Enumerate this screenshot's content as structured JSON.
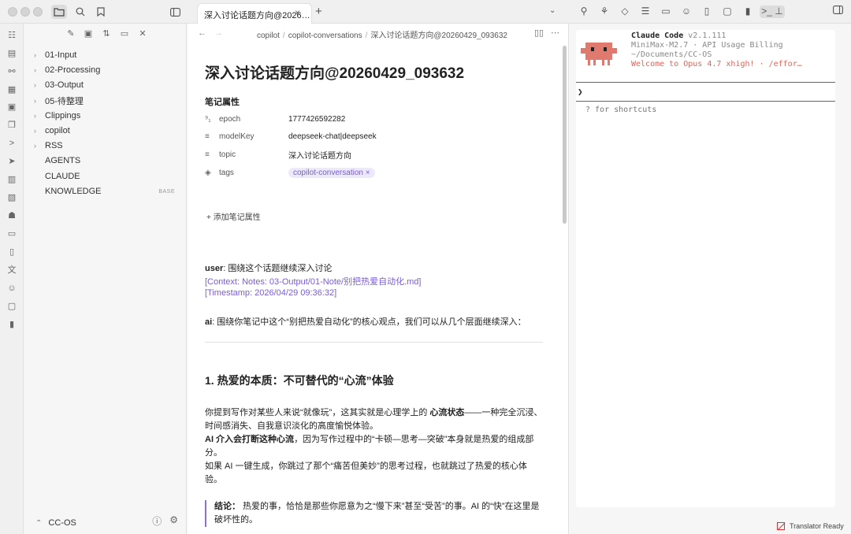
{
  "tab": {
    "title": "深入讨论话题方向@2026…",
    "close": "×",
    "add": "+",
    "menu": "⌄"
  },
  "breadcrumb": {
    "items": [
      "copilot",
      "copilot-conversations",
      "深入讨论话题方向@20260429_093632"
    ],
    "separator": "/"
  },
  "sidebar": {
    "items": [
      {
        "label": "01-Input",
        "type": "folder"
      },
      {
        "label": "02-Processing",
        "type": "folder"
      },
      {
        "label": "03-Output",
        "type": "folder"
      },
      {
        "label": "05-待整理",
        "type": "folder"
      },
      {
        "label": "Clippings",
        "type": "folder"
      },
      {
        "label": "copilot",
        "type": "folder"
      },
      {
        "label": "RSS",
        "type": "folder"
      },
      {
        "label": "AGENTS",
        "type": "file"
      },
      {
        "label": "CLAUDE",
        "type": "file"
      },
      {
        "label": "KNOWLEDGE",
        "type": "file",
        "badge": "BASE"
      }
    ],
    "vault_name": "CC-OS"
  },
  "note": {
    "title": "深入讨论话题方向@20260429_093632",
    "properties_heading": "笔记属性",
    "properties": [
      {
        "icon": "number-icon",
        "key": "epoch",
        "value": "1777426592282"
      },
      {
        "icon": "text-icon",
        "key": "modelKey",
        "value": "deepseek-chat|deepseek"
      },
      {
        "icon": "text-icon",
        "key": "topic",
        "value": "深入讨论话题方向"
      },
      {
        "icon": "tag-icon",
        "key": "tags",
        "value": "copilot-conversation"
      }
    ],
    "add_property": "添加笔记属性",
    "user_label": "user",
    "user_message": ": 围绕这个话题继续深入讨论",
    "context_line": "[Context: Notes: 03-Output/01-Note/别把热爱自动化.md]",
    "timestamp_line": "[Timestamp: 2026/04/29 09:36:32]",
    "ai_label": "ai",
    "ai_message": ": 围绕你笔记中这个“别把热爱自动化”的核心观点，我们可以从几个层面继续深入：",
    "section_heading": "1. 热爱的本质：不可替代的“心流”体验",
    "para1_pre": "你提到写作对某些人来说“就像玩”，这其实就是心理学上的 ",
    "para1_bold": "心流状态",
    "para1_post": "——一种完全沉浸、时间感消失、自我意识淡化的高度愉悦体验。",
    "para2_bold": "AI 介入会打断这种心流",
    "para2_post": "，因为写作过程中的“卡顿—思考—突破”本身就是热爱的组成部分。",
    "para3": "如果 AI 一键生成，你跳过了那个“痛苦但美妙”的思考过程，也就跳过了热爱的核心体验。",
    "quote_bold": "结论：",
    "quote_text": " 热爱的事，恰恰是那些你愿意为之“慢下来”甚至“受苦”的事。AI 的“快”在这里是破坏性的。"
  },
  "terminal": {
    "app_name": "Claude Code",
    "version": "v2.1.111",
    "model_line": "MiniMax-M2.7 · API Usage Billing",
    "path_line": "~/Documents/CC-OS",
    "welcome_line": "Welcome to Opus 4.7 xhigh! · /effor…",
    "prompt": "❯",
    "hint": "? for shortcuts"
  },
  "status": {
    "translator": "Translator Ready"
  },
  "colors": {
    "accent": "#7a5cd6",
    "mascot": "#e07a6e",
    "welcome": "#e0655a"
  }
}
